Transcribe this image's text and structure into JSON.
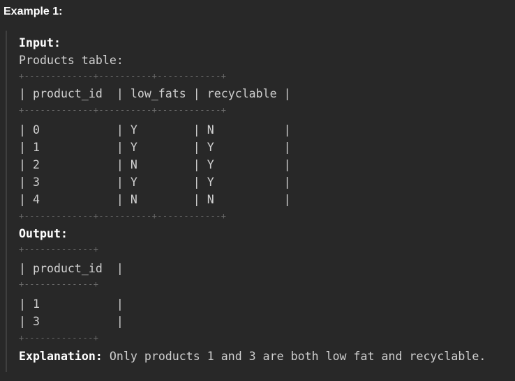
{
  "heading": "Example 1:",
  "input": {
    "label": "Input:",
    "table_name": "Products table:",
    "border": "+-------------+----------+------------+",
    "header_row": "| product_id  | low_fats | recyclable |",
    "rows": [
      "| 0           | Y        | N          |",
      "| 1           | Y        | Y          |",
      "| 2           | N        | Y          |",
      "| 3           | Y        | Y          |",
      "| 4           | N        | N          |"
    ]
  },
  "output": {
    "label": "Output:",
    "border": "+-------------+",
    "header_row": "| product_id  |",
    "rows": [
      "| 1           |",
      "| 3           |"
    ]
  },
  "explanation": {
    "label": "Explanation:",
    "text": " Only products 1 and 3 are both low fat and recyclable."
  }
}
